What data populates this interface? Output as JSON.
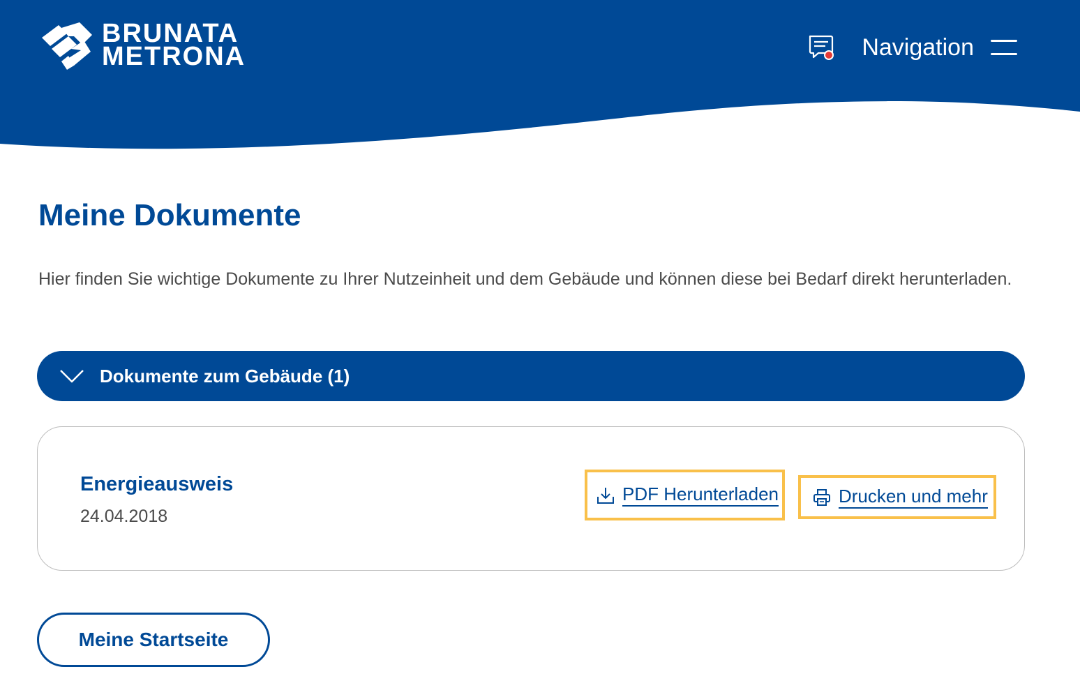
{
  "brand": {
    "line1": "BRUNATA",
    "line2": "METRONA"
  },
  "header": {
    "nav_label": "Navigation",
    "message_icon": "message-notification-icon",
    "menu_icon": "hamburger-menu-icon"
  },
  "page": {
    "title": "Meine Dokumente",
    "intro": "Hier finden Sie wichtige Dokumente zu Ihrer Nutzeinheit und dem Gebäude und können diese bei Bedarf direkt herunterladen."
  },
  "accordion": {
    "label": "Dokumente zum Gebäude (1)",
    "icon": "chevron-down-icon"
  },
  "documents": [
    {
      "name": "Energieausweis",
      "date": "24.04.2018",
      "actions": {
        "download_label": "PDF Herunterladen",
        "download_icon": "download-icon",
        "print_label": "Drucken und mehr",
        "print_icon": "printer-icon"
      }
    }
  ],
  "footer": {
    "home_label": "Meine Startseite"
  },
  "colors": {
    "brand_blue": "#004996",
    "highlight": "#f9c04a",
    "notification_dot": "#e53935"
  }
}
